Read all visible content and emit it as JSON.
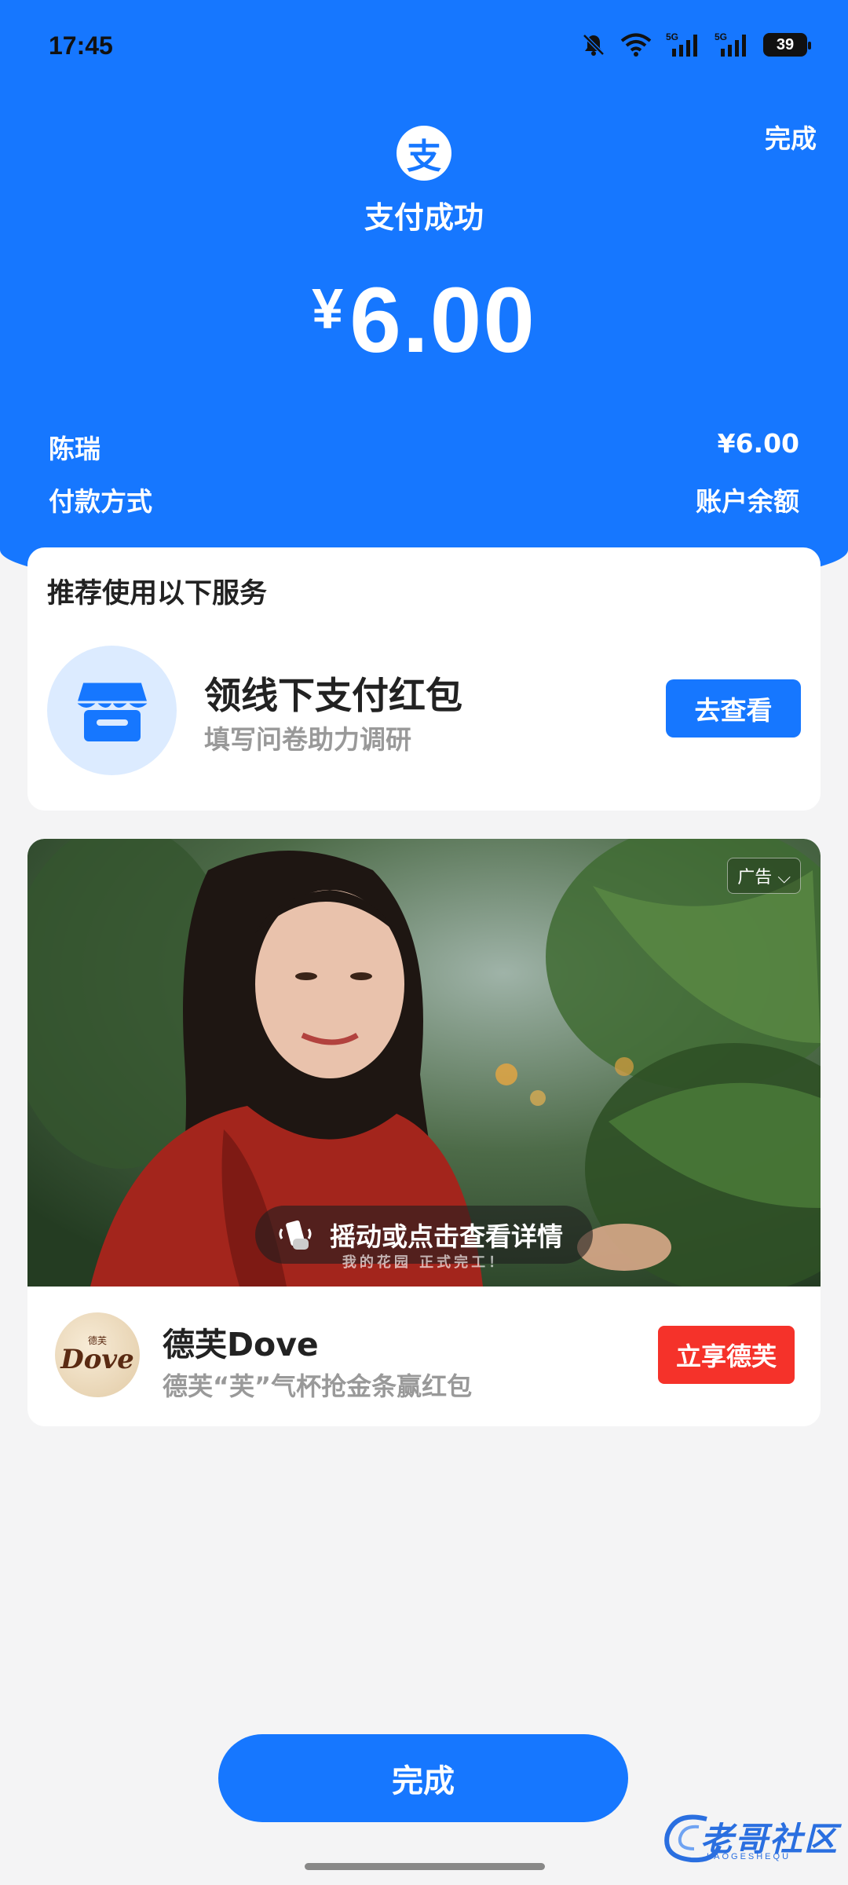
{
  "status_bar": {
    "time": "17:45",
    "battery": "39",
    "icons": [
      "mute-bell-icon",
      "wifi-icon",
      "5g-signal-icon",
      "5g-signal-icon",
      "battery-icon"
    ]
  },
  "header": {
    "top_done": "完成",
    "logo_glyph": "支",
    "title": "支付成功",
    "currency_symbol": "¥",
    "amount": "6.00"
  },
  "details": {
    "payee": "陈瑞",
    "payee_amount": "¥6.00",
    "method_label": "付款方式",
    "method_value": "账户余额"
  },
  "service_card": {
    "title": "推荐使用以下服务",
    "icon": "store-icon",
    "name": "领线下支付红包",
    "subtitle": "填写问卷助力调研",
    "button": "去查看"
  },
  "ad_card": {
    "tag": "广告",
    "shake_text": "摇动或点击查看详情",
    "caption": "我的花园 正式完工！",
    "brand_logo_small": "德芙",
    "brand_logo_main": "Dove",
    "brand_name": "德芙Dove",
    "brand_subtitle": "德芙“芙”气杯抢金条赢红包",
    "button": "立享德芙"
  },
  "footer": {
    "done_button": "完成"
  },
  "watermark": {
    "text": "老哥社区",
    "sub": "LAOGESHEQU"
  },
  "colors": {
    "primary": "#1677ff",
    "ad_button": "#f5322a",
    "background": "#f4f4f5"
  }
}
